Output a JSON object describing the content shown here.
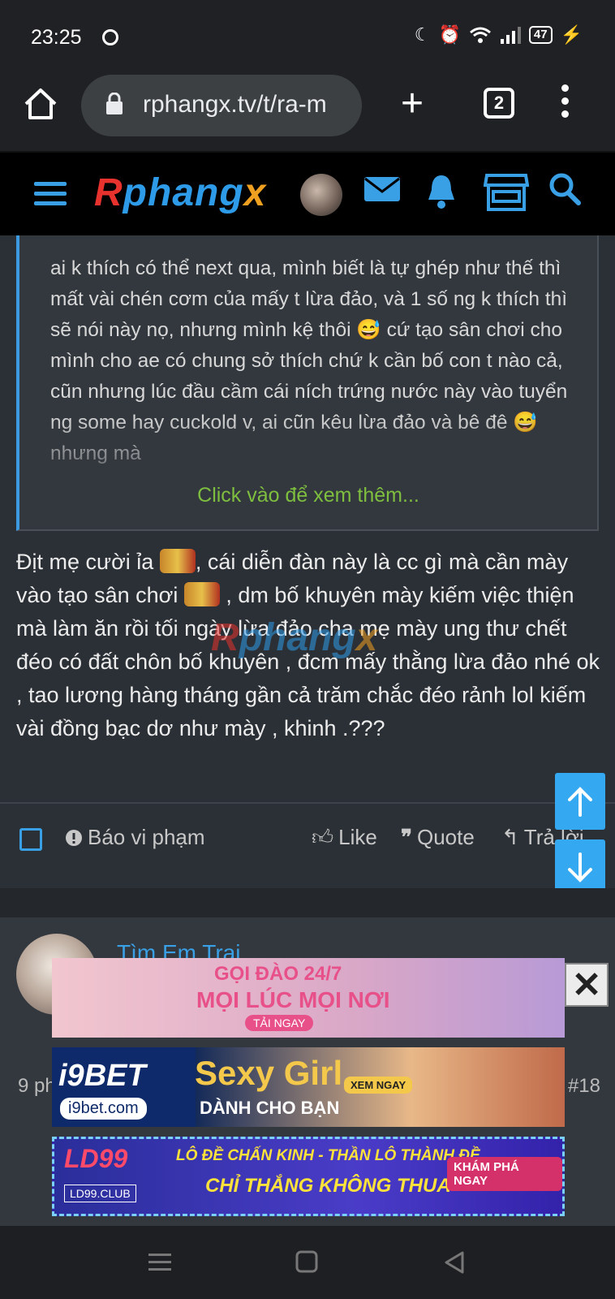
{
  "status_bar": {
    "time": "23:25",
    "battery": "47"
  },
  "browser": {
    "url": "rphangx.tv/t/ra-m",
    "tab_count": "2"
  },
  "site": {
    "logo": "Rphangx"
  },
  "quote": {
    "text": "ai k thích có thể next qua, mình biết là tự ghép như thế thì mất vài chén cơm của mấy t lừa đảo, và 1 số ng k thích thì sẽ nói này nọ, nhưng mình kệ thôi 😅 cứ tạo sân chơi cho mình cho ae có chung sở thích chứ k cần bố con t nào cả, cũn nhưng lúc đầu cầm cái ních trứng nước này vào tuyển ng some hay cuckold v, ai cũn kêu lừa đảo và bê đê 😅 nhưng mà",
    "more_label": "Click vào để xem thêm..."
  },
  "post": {
    "line1a": "Địt mẹ cười ỉa",
    "line1b": ", cái diễn đàn này là cc gì mà cần mày vào tạo sân chơi",
    "line1c": ", dm bố khuyên mày kiếm việc thiện mà làm ăn rồi tối ngày lừa đảo cha mẹ mày ung thư chết đéo có đất chôn bố khuyên , đcm mấy thằng lừa đảo nhé ok , tao lương hàng tháng gần cả trăm chắc đéo rảnh lol kiếm vài đồng bạc dơ như mày , khinh .???"
  },
  "actions": {
    "report": "Báo vi phạm",
    "like": "Like",
    "quote": "Quote",
    "reply": "Trả lời"
  },
  "next_post": {
    "username": "Tìm Em Trai",
    "time": "9 ph",
    "number": "#18"
  },
  "ads": {
    "ad1": {
      "line1": "GỌI ĐÀO 24/7",
      "line2": "MỌI LÚC MỌI NƠI",
      "cta": "TẢI NGAY"
    },
    "ad2": {
      "brand": "i9BET",
      "domain": "i9bet.com",
      "title": "Sexy Girl",
      "sub": "DÀNH CHO BẠN",
      "cta": "XEM NGAY"
    },
    "ad3": {
      "brand": "LD99",
      "domain": "LD99.CLUB",
      "line1": "LÔ ĐỀ CHẤN KINH - THẦN LÔ THÀNH ĐỀ",
      "line2": "CHỈ THẮNG KHÔNG THUA",
      "cta": "KHÁM PHÁ NGAY"
    },
    "close": "✕"
  },
  "colors": {
    "accent": "#3aa0e6",
    "more_link": "#7fbf3f",
    "scroll_button": "#34a8f0"
  }
}
